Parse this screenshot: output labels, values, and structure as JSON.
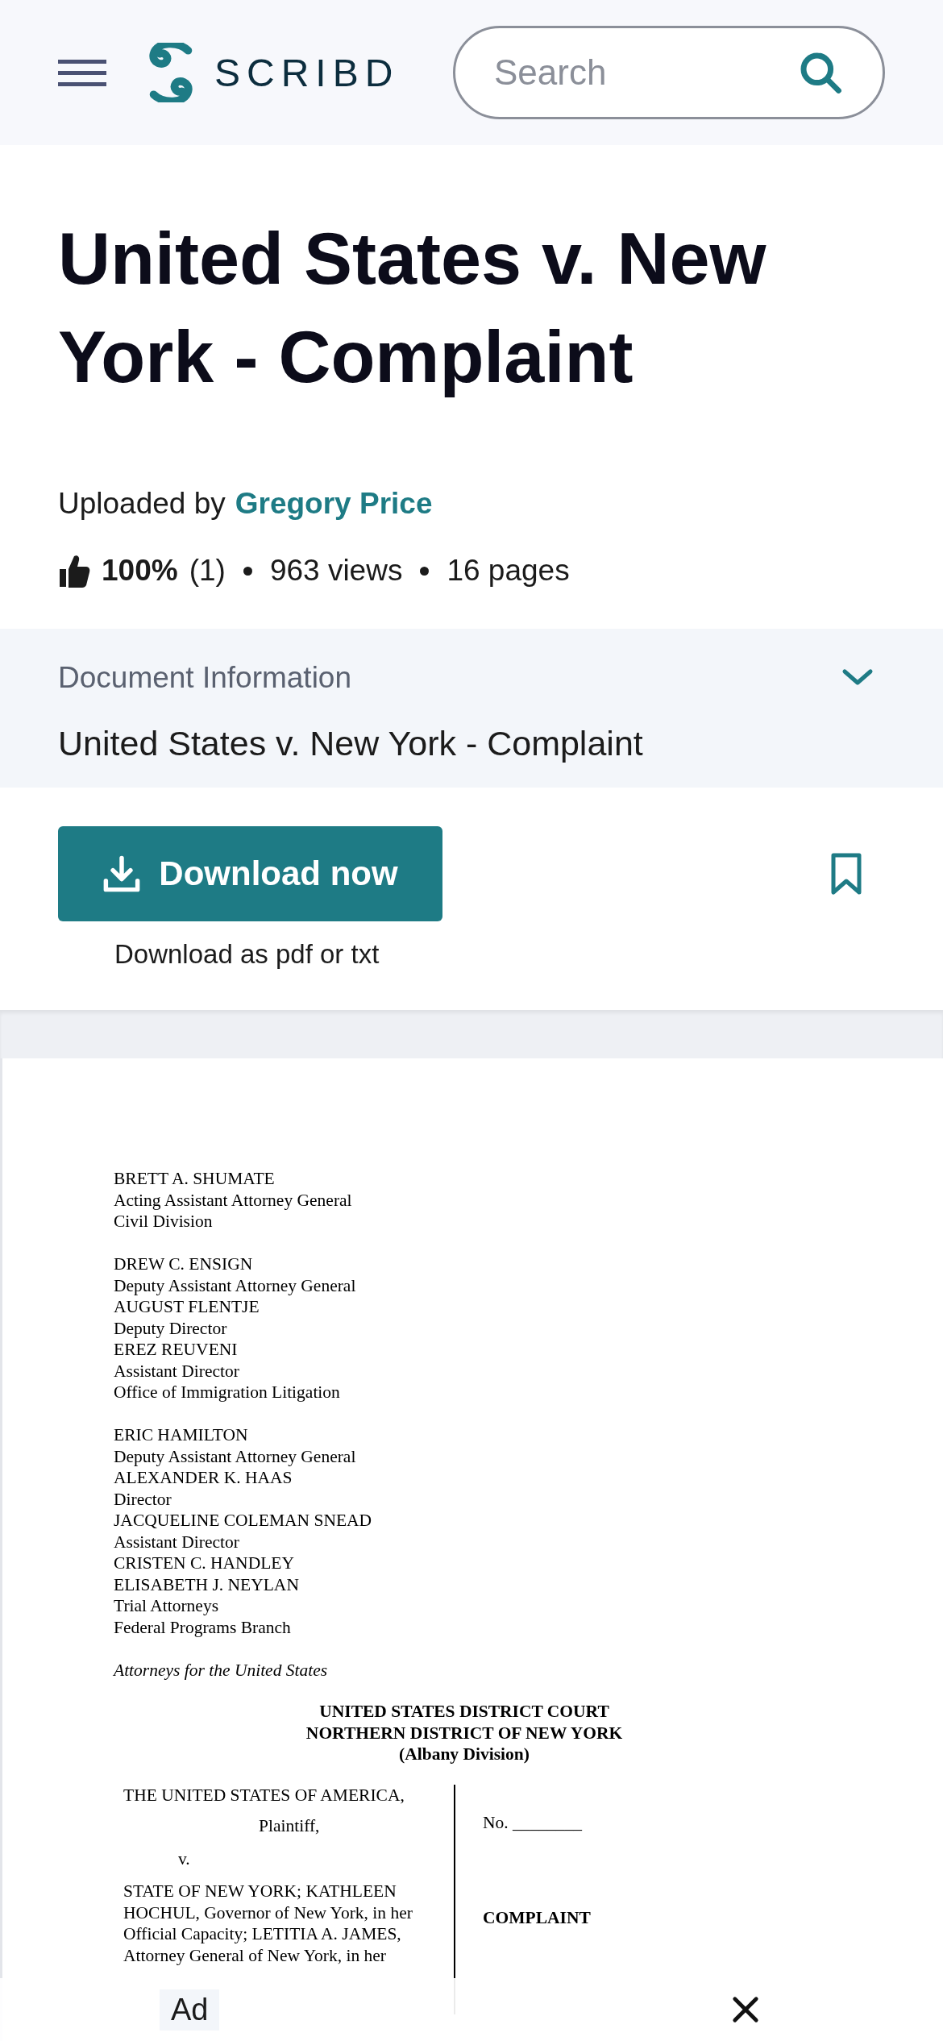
{
  "header": {
    "logo_text": "SCRIBD",
    "search": {
      "placeholder": "Search"
    }
  },
  "document": {
    "title": "United States v. New York - Complaint",
    "uploaded_by_label": "Uploaded by",
    "uploader": "Gregory Price",
    "rating": "100%",
    "rating_count": "(1)",
    "views": "963 views",
    "pages": "16 pages"
  },
  "info_panel": {
    "label": "Document Information",
    "value": "United States v. New York - Complaint",
    "expanded": false
  },
  "download": {
    "button": "Download now",
    "note": "Download as pdf or txt"
  },
  "page": {
    "counsel_blocks": [
      [
        "BRETT A. SHUMATE",
        "Acting Assistant Attorney General",
        "Civil Division"
      ],
      [
        "DREW C. ENSIGN",
        "Deputy Assistant Attorney General",
        "AUGUST FLENTJE",
        "Deputy Director",
        "EREZ REUVENI",
        "Assistant Director",
        "Office of Immigration Litigation"
      ],
      [
        "ERIC HAMILTON",
        "Deputy Assistant Attorney General",
        "ALEXANDER K. HAAS",
        "Director",
        "JACQUELINE COLEMAN SNEAD",
        "Assistant Director",
        "CRISTEN C. HANDLEY",
        "ELISABETH J. NEYLAN",
        "Trial Attorneys",
        "Federal Programs Branch"
      ]
    ],
    "counsel_role": "Attorneys for the United States",
    "court_heading": [
      "UNITED STATES DISTRICT COURT",
      "NORTHERN DISTRICT OF NEW YORK",
      "(Albany Division)"
    ],
    "caption": {
      "plaintiff": "THE UNITED STATES OF AMERICA,",
      "plaintiff_role": "Plaintiff,",
      "versus": "v.",
      "defendants": [
        "STATE OF NEW YORK; KATHLEEN",
        "HOCHUL, Governor of New York, in her",
        "Official Capacity; LETITIA A. JAMES,",
        "Attorney General of New York, in her"
      ],
      "case_no": "No. ________",
      "doc_type": "COMPLAINT"
    }
  },
  "ad": {
    "label": "Ad"
  }
}
